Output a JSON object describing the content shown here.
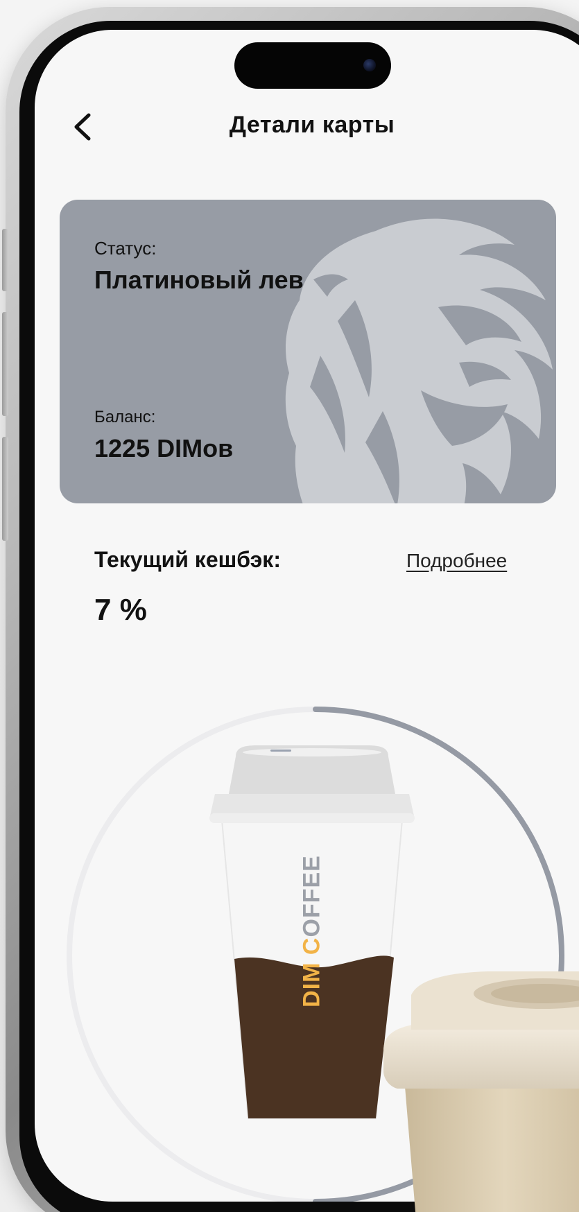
{
  "header": {
    "title": "Детали карты"
  },
  "card": {
    "status_label": "Статус:",
    "status_value": "Платиновый лев",
    "balance_label": "Баланс:",
    "balance_value": "1225 DIMов",
    "color": "#979ca5"
  },
  "cashback": {
    "label": "Текущий кешбэк:",
    "value": "7 %",
    "details_link": "Подробнее"
  },
  "progress": {
    "fraction": 0.5,
    "track_color": "#e8e8ea",
    "fill_color": "#959aa4"
  },
  "cup": {
    "brand_prefix": "DIM ",
    "brand_c": "C",
    "brand_suffix": "OFFEE",
    "accent": "#f2b347",
    "coffee_color": "#4b3322"
  },
  "icons": {
    "back": "chevron-left-icon",
    "lion": "lion-head-icon"
  }
}
